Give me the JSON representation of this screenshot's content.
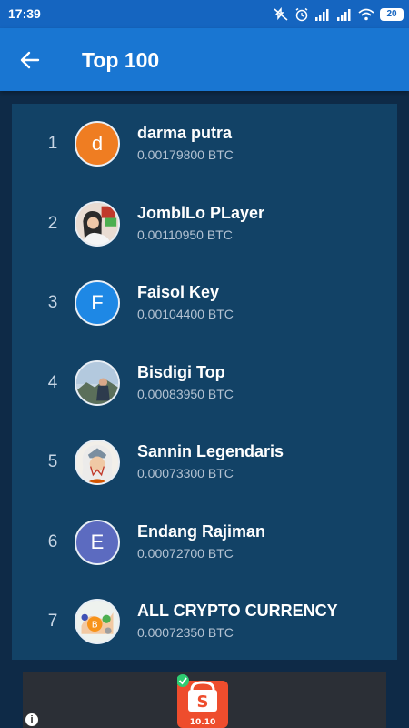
{
  "status_bar": {
    "time": "17:39",
    "battery": "20"
  },
  "app_bar": {
    "title": "Top 100"
  },
  "leaderboard": [
    {
      "rank": "1",
      "name": "darma putra",
      "amount": "0.00179800 BTC",
      "avatar_letter": "d",
      "avatar_color": "#ef7d22"
    },
    {
      "rank": "2",
      "name": "JomblLo PLayer",
      "amount": "0.00110950 BTC",
      "avatar_letter": "",
      "avatar_color": "#d9c7bb"
    },
    {
      "rank": "3",
      "name": "Faisol Key",
      "amount": "0.00104400 BTC",
      "avatar_letter": "F",
      "avatar_color": "#1e88e5"
    },
    {
      "rank": "4",
      "name": "Bisdigi Top",
      "amount": "0.00083950 BTC",
      "avatar_letter": "",
      "avatar_color": "#9fb8cf"
    },
    {
      "rank": "5",
      "name": "Sannin Legendaris",
      "amount": "0.00073300 BTC",
      "avatar_letter": "",
      "avatar_color": "#e9e4dc"
    },
    {
      "rank": "6",
      "name": "Endang Rajiman",
      "amount": "0.00072700 BTC",
      "avatar_letter": "E",
      "avatar_color": "#5c6bc0"
    },
    {
      "rank": "7",
      "name": "ALL CRYPTO CURRENCY",
      "amount": "0.00072350 BTC",
      "avatar_letter": "",
      "avatar_color": "#dfe6df"
    }
  ],
  "ad": {
    "badge_text": "10.10",
    "info_label": "i"
  },
  "colors": {
    "status_bar": "#1565c0",
    "app_bar": "#1976d2",
    "background": "#0e2a47",
    "card": "#124266"
  }
}
